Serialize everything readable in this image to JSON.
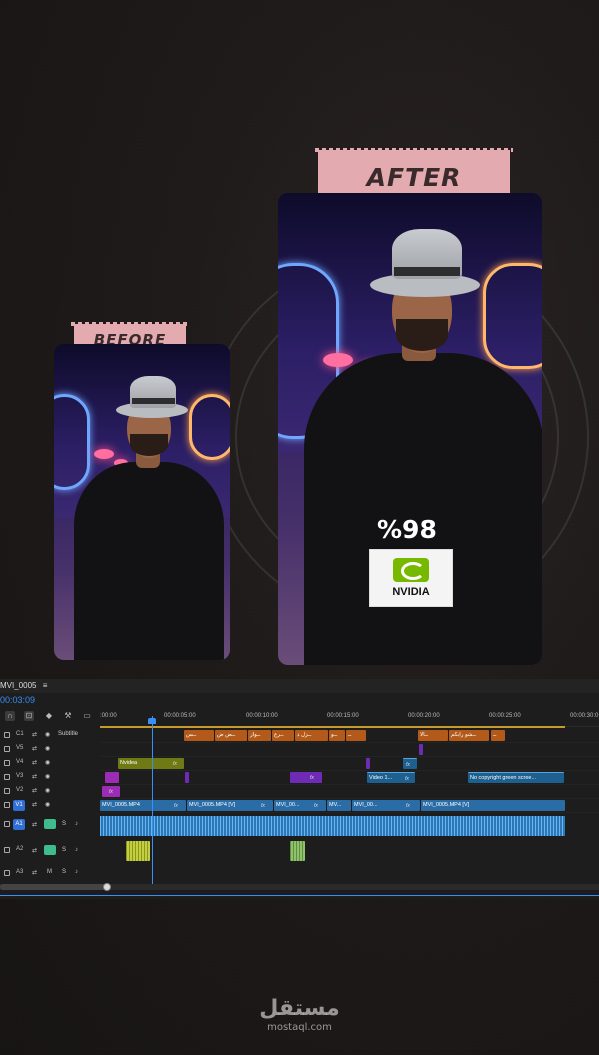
{
  "labels": {
    "before": "BEFORE",
    "after": "AFTER"
  },
  "badge": {
    "percent": "%98",
    "brand": "NVIDIA"
  },
  "colors": {
    "tape": "#e3aab0",
    "playhead": "#3a8ef6",
    "subtitle_clip": "#b35a1a",
    "nvidia_green": "#76b900"
  },
  "premiere": {
    "sequence_name": "MVI_0005",
    "timecode": "00:03:09",
    "ruler": [
      ":00:00",
      "00:00:05:00",
      "00:00:10:00",
      "00:00:15:00",
      "00:00:20:00",
      "00:00:25:00",
      "00:00:30:0"
    ],
    "tracks": {
      "c1": {
        "name": "C1",
        "label": "Subtitle"
      },
      "v5": {
        "name": "V5"
      },
      "v4": {
        "name": "V4"
      },
      "v3": {
        "name": "V3"
      },
      "v2": {
        "name": "V2"
      },
      "v1": {
        "name": "V1"
      },
      "a1": {
        "name": "A1"
      },
      "a2": {
        "name": "A2"
      },
      "a3": {
        "name": "A3"
      }
    },
    "subtitle_clips": [
      "ــس",
      "ــض ض",
      "ــواز",
      "ــرع",
      "ــزل د",
      "ــو",
      "ــ",
      "ــالا",
      "ــشو رابكم",
      "ــ"
    ],
    "v4_clip": "Nvidea",
    "v3_clips": [
      "Video 1...",
      "No copyright green scree..."
    ],
    "v1_clips": [
      "MVI_0005.MP4",
      "MVI_0005.MP4 [V]",
      "MVI_00...",
      "MV...",
      "MVI_00...",
      "MVI_0005.MP4 [V]"
    ],
    "fx": "fx",
    "track_icons": {
      "m": "M",
      "s": "S"
    }
  },
  "watermark": {
    "arabic": "مستقل",
    "latin": "mostaql.com"
  }
}
